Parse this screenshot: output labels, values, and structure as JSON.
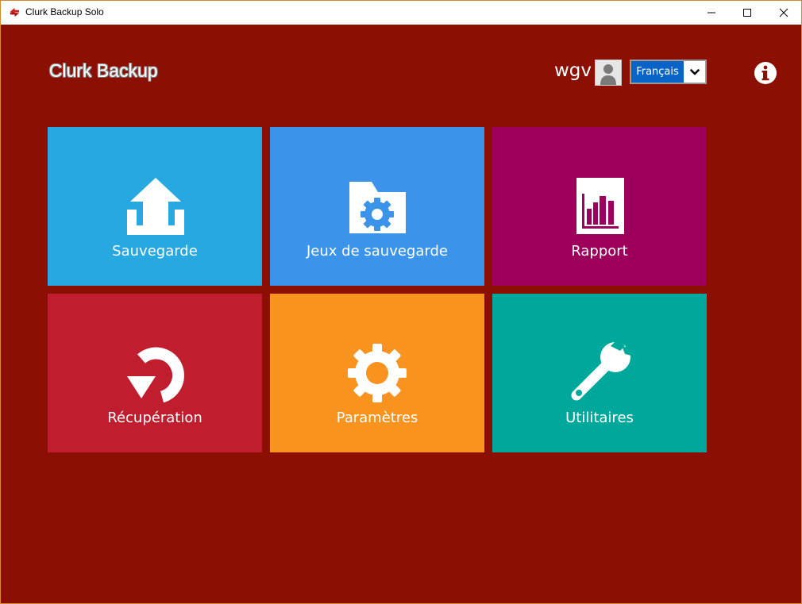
{
  "window": {
    "title": "Clurk Backup Solo",
    "controls": {
      "minimize": "minimize-icon",
      "maximize": "maximize-icon",
      "close": "close-icon"
    }
  },
  "header": {
    "title": "Clurk Backup",
    "username": "wgv",
    "language": "Français",
    "info_icon": "info-icon"
  },
  "colors": {
    "background": "#8b0f02",
    "sauvegarde": "#27a8e0",
    "jeux": "#3b94ea",
    "rapport": "#9c005a",
    "recuperation": "#c01e2e",
    "parametres": "#f7931e",
    "utilitaires": "#00a89c"
  },
  "tiles": [
    {
      "label": "Sauvegarde",
      "icon": "upload-icon"
    },
    {
      "label": "Jeux de sauvegarde",
      "icon": "folder-gear-icon"
    },
    {
      "label": "Rapport",
      "icon": "bar-chart-icon"
    },
    {
      "label": "Récupération",
      "icon": "restore-icon"
    },
    {
      "label": "Paramètres",
      "icon": "gear-icon"
    },
    {
      "label": "Utilitaires",
      "icon": "wrench-icon"
    }
  ]
}
